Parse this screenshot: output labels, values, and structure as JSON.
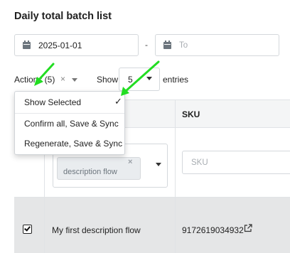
{
  "page": {
    "title": "Daily total batch list"
  },
  "filters": {
    "date_from_value": "2025-01-01",
    "date_separator": "-",
    "date_to_placeholder": "To"
  },
  "toolbar": {
    "actions_label": "Actions (5)",
    "clear_symbol": "×",
    "show_label": "Show",
    "show_value": "5",
    "entries_label": "entries"
  },
  "actions_menu": {
    "items": [
      {
        "label": "Show Selected",
        "checked_symbol": "✓"
      },
      {
        "label": "Confirm all, Save & Sync"
      },
      {
        "label": "Regenerate, Save & Sync"
      }
    ]
  },
  "table": {
    "headers": {
      "sku": "SKU"
    },
    "filters": {
      "description_tag": "description flow",
      "tag_remove": "×",
      "sku_placeholder": "SKU"
    },
    "rows": [
      {
        "name": "My first description flow",
        "sku": "9172619034932",
        "selected": true
      }
    ]
  },
  "annotation": {
    "arrow_color": "#22dd22"
  }
}
